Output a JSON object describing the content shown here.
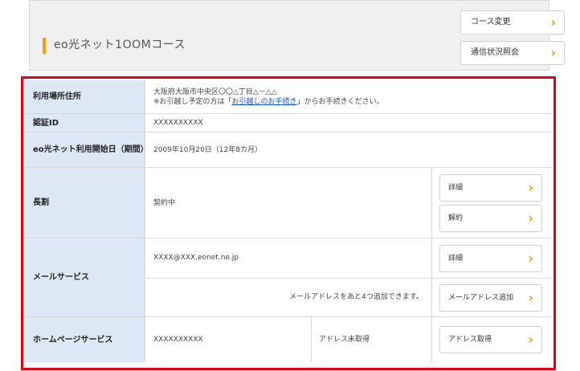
{
  "course": {
    "title": "eo光ネット1OOMコース",
    "change_btn": "コース変更",
    "status_btn": "通信状況照会"
  },
  "info": {
    "address_label": "利用場所住所",
    "address_line1": "大阪府大阪市中央区〇〇△丁目△－△△",
    "address_note_pre": "※お引越し予定の方は「",
    "address_link": "お引越しのお手続き",
    "address_note_post": "」からお手続きください。",
    "auth_label": "認証ID",
    "auth_value": "XXXXXXXXXX",
    "start_label": "eo光ネット利用開始日（期間）",
    "start_value": "2009年10月20日（12年8カ月）",
    "discount_label": "長割",
    "discount_value": "契約中",
    "discount_detail_btn": "詳細",
    "discount_cancel_btn": "解約",
    "mail_label": "メールサービス",
    "mail_address": "XXXX@XXX.eonet.ne.jp",
    "mail_detail_btn": "詳細",
    "mail_note": "メールアドレスをあと4つ追加できます。",
    "mail_add_btn": "メールアドレス追加",
    "hp_label": "ホームページサービス",
    "hp_value": "XXXXXXXXXX",
    "hp_status": "アドレス未取得",
    "hp_btn": "アドレス取得"
  },
  "colors": {
    "accent": "#f0a000",
    "highlight_frame": "#e60012",
    "label_bg": "#dde8f6",
    "link": "#1a4fc4"
  }
}
